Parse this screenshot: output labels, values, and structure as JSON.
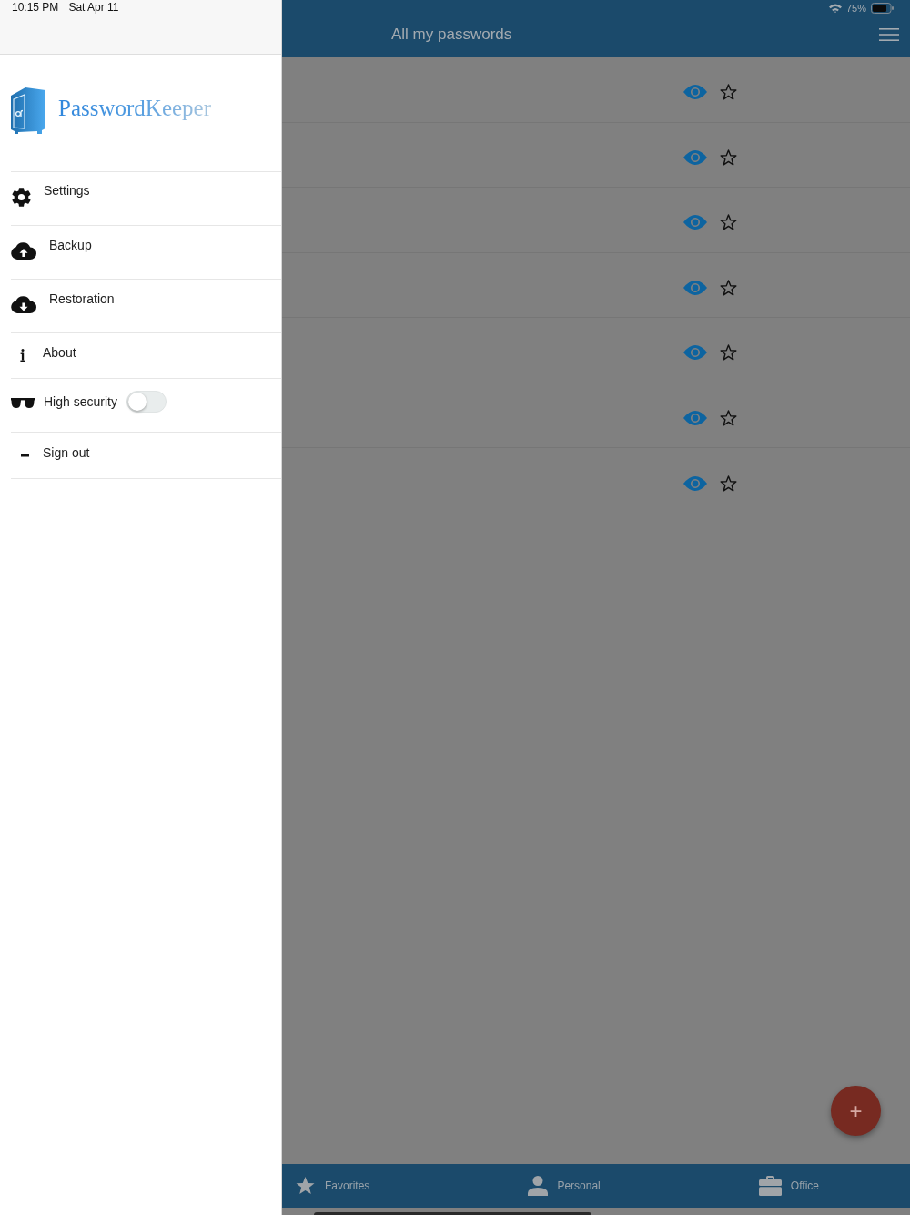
{
  "status_bar": {
    "time": "10:15 PM",
    "date": "Sat Apr 11",
    "battery": "75%"
  },
  "drawer": {
    "brand": "PasswordKeeper",
    "items": [
      {
        "kind": "link",
        "label": "Settings"
      },
      {
        "kind": "link",
        "label": "Backup"
      },
      {
        "kind": "link",
        "label": "Restoration"
      },
      {
        "kind": "link",
        "label": "About"
      },
      {
        "kind": "toggle",
        "label": "High security",
        "on": false
      },
      {
        "kind": "link",
        "label": "Sign out"
      }
    ]
  },
  "header": {
    "title": "All my passwords"
  },
  "rows": [
    {
      "favorite": false
    },
    {
      "favorite": false
    },
    {
      "favorite": false
    },
    {
      "favorite": false
    },
    {
      "favorite": false
    },
    {
      "favorite": false
    },
    {
      "favorite": false
    }
  ],
  "fab": {
    "label": "+"
  },
  "tabs": [
    {
      "label": "Favorites",
      "selected": false
    },
    {
      "label": "Personal",
      "selected": false
    },
    {
      "label": "Office",
      "selected": false
    }
  ]
}
